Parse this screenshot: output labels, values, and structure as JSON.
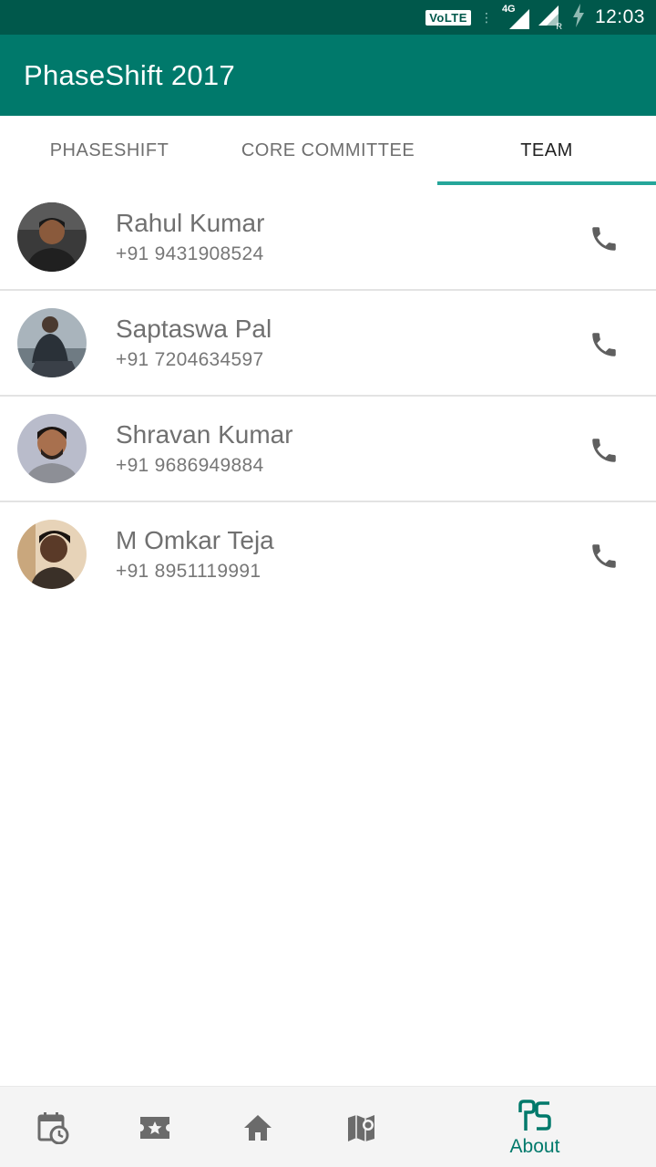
{
  "status_bar": {
    "volte": "VoLTE",
    "network": "4G",
    "roaming": "R",
    "time": "12:03"
  },
  "app_bar": {
    "title": "PhaseShift 2017"
  },
  "tabs": [
    {
      "label": "PHASESHIFT",
      "active": false
    },
    {
      "label": "CORE COMMITTEE",
      "active": false
    },
    {
      "label": "TEAM",
      "active": true
    }
  ],
  "team": [
    {
      "name": "Rahul Kumar",
      "phone": "+91 9431908524"
    },
    {
      "name": "Saptaswa Pal",
      "phone": "+91 7204634597"
    },
    {
      "name": "Shravan Kumar",
      "phone": "+91 9686949884"
    },
    {
      "name": "M Omkar Teja",
      "phone": "+91 8951119991"
    }
  ],
  "bottom_nav": {
    "items": [
      {
        "icon": "schedule-calendar-icon"
      },
      {
        "icon": "events-ticket-icon"
      },
      {
        "icon": "home-icon"
      },
      {
        "icon": "map-icon"
      },
      {
        "icon": "phaseshift-logo-icon",
        "label": "About",
        "active": true
      }
    ]
  },
  "colors": {
    "status_bar": "#00584b",
    "app_bar": "#00796b",
    "tab_indicator": "#26a69a",
    "active_nav": "#00796b"
  }
}
